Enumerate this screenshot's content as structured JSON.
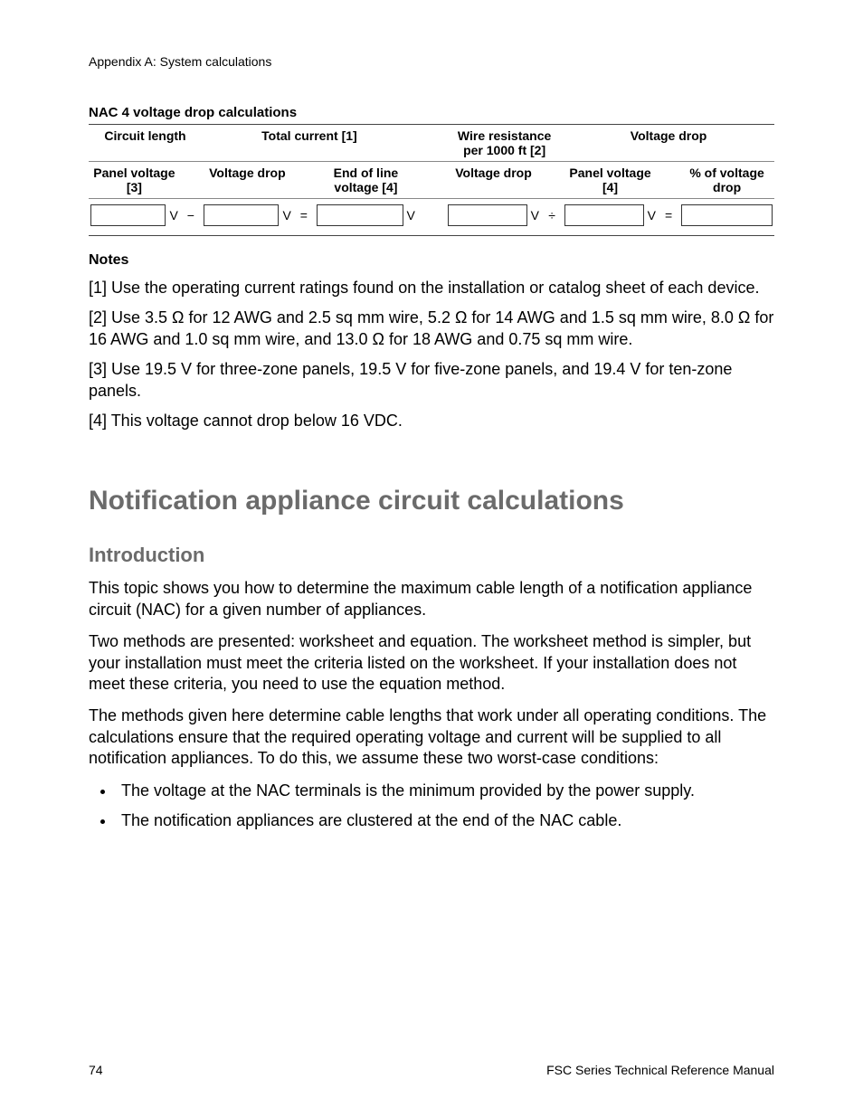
{
  "header": {
    "running": "Appendix A: System calculations"
  },
  "table": {
    "title": "NAC 4 voltage drop calculations",
    "row1": {
      "c1": "Circuit length",
      "c2": "Total current [1]",
      "c3": "Wire resistance per 1000 ft [2]",
      "c4": "Voltage drop"
    },
    "row2": {
      "c1": "Panel voltage [3]",
      "c2": "Voltage drop",
      "c3": "End of line voltage [4]",
      "c4": "Voltage drop",
      "c5": "Panel voltage [4]",
      "c6": "% of voltage drop"
    },
    "units": {
      "v": "V",
      "minus": "−",
      "equals": "=",
      "divide": "÷"
    }
  },
  "notes": {
    "heading": "Notes",
    "n1": "[1] Use the operating current ratings found on the installation or catalog sheet of each device.",
    "n2": "[2] Use 3.5 Ω for 12 AWG and 2.5 sq mm wire, 5.2 Ω for 14 AWG and 1.5 sq mm wire, 8.0 Ω for 16 AWG and 1.0 sq mm wire, and 13.0 Ω for 18 AWG and 0.75 sq mm wire.",
    "n3": "[3] Use 19.5 V for three-zone panels, 19.5 V for five-zone panels, and 19.4 V for ten-zone panels.",
    "n4": "[4] This voltage cannot drop below 16 VDC."
  },
  "section": {
    "h1": "Notification appliance circuit calculations",
    "h2": "Introduction",
    "p1": "This topic shows you how to determine the maximum cable length of a notification appliance circuit (NAC) for a given number of appliances.",
    "p2": "Two methods are presented: worksheet and equation. The worksheet method is simpler, but your installation must meet the criteria listed on the worksheet. If your installation does not meet these criteria, you need to use the equation method.",
    "p3": "The methods given here determine cable lengths that work under all operating conditions. The calculations ensure that the required operating voltage and current will be supplied to all notification appliances. To do this, we assume these two worst-case conditions:",
    "b1": "The voltage at the NAC terminals is the minimum provided by the power supply.",
    "b2": "The notification appliances are clustered at the end of the NAC cable."
  },
  "footer": {
    "page": "74",
    "doc": "FSC Series Technical Reference Manual"
  }
}
